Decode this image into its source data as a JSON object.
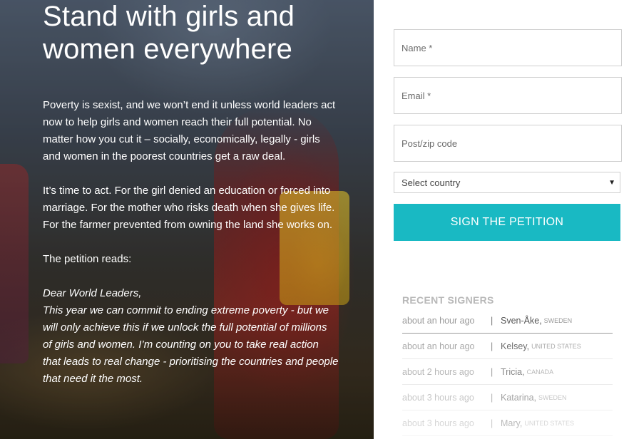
{
  "hero": {
    "title": "Stand with girls and women everywhere",
    "paragraphs": [
      "Poverty is sexist, and we won’t end it unless world leaders act now to help girls and women reach their full potential. No matter how you cut it – socially, economically, legally - girls and women in the poorest countries get a raw deal.",
      "It’s time to act. For the girl denied an education or forced into marriage. For the mother who risks death when she gives life. For the farmer prevented from owning the land she works on.",
      "The petition reads:"
    ],
    "quote_salutation": "Dear World Leaders,",
    "quote_body": "This year we can commit to ending extreme poverty - but we will only achieve this if we unlock the full potential of millions of girls and women. I’m counting on you to take real action that leads to real change - prioritising the countries and people that need it the most."
  },
  "form": {
    "name_placeholder": "Name *",
    "email_placeholder": "Email *",
    "postcode_placeholder": "Post/zip code",
    "country_selected": "Select country",
    "submit_label": "SIGN THE PETITION"
  },
  "recent": {
    "title": "RECENT SIGNERS",
    "signers": [
      {
        "time": "about an hour ago",
        "name": "Sven-Åke,",
        "country": "SWEDEN"
      },
      {
        "time": "about an hour ago",
        "name": "Kelsey,",
        "country": "UNITED STATES"
      },
      {
        "time": "about 2 hours ago",
        "name": "Tricia,",
        "country": "CANADA"
      },
      {
        "time": "about 3 hours ago",
        "name": "Katarina,",
        "country": "SWEDEN"
      },
      {
        "time": "about 3 hours ago",
        "name": "Mary,",
        "country": "UNITED STATES"
      }
    ]
  },
  "colors": {
    "accent": "#19b9c3"
  },
  "icons": {
    "select_caret": "caret-down-icon"
  }
}
